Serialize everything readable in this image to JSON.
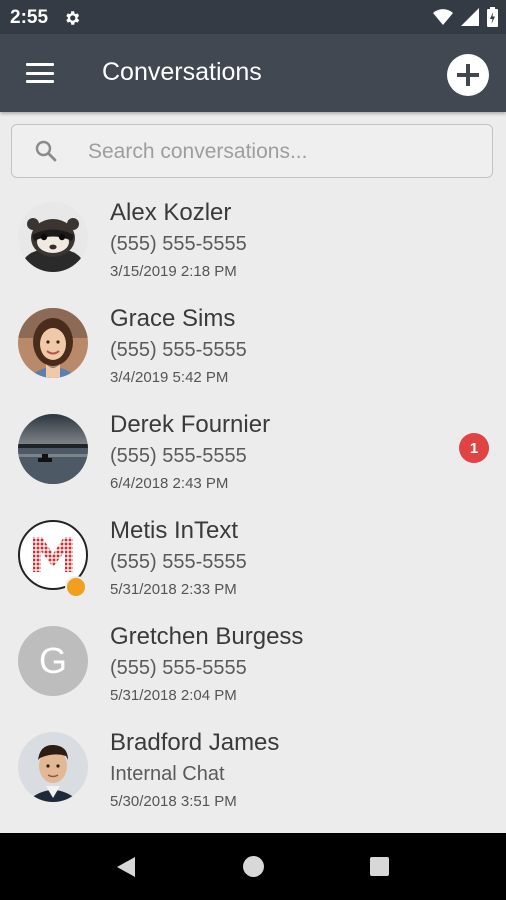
{
  "status_bar": {
    "time": "2:55",
    "icons": [
      "gear-icon",
      "wifi-icon",
      "signal-icon",
      "battery-icon"
    ]
  },
  "app_bar": {
    "title": "Conversations",
    "menu_icon": "menu-icon",
    "add_icon": "plus-icon"
  },
  "search": {
    "placeholder": "Search conversations...",
    "value": ""
  },
  "conversations": [
    {
      "name": "Alex Kozler",
      "subtitle": "(555) 555-5555",
      "timestamp": "3/15/2019 2:18 PM",
      "avatar": "ferret-photo"
    },
    {
      "name": "Grace Sims",
      "subtitle": "(555) 555-5555",
      "timestamp": "3/4/2019 5:42 PM",
      "avatar": "woman-photo"
    },
    {
      "name": "Derek Fournier",
      "subtitle": "(555) 555-5555",
      "timestamp": "6/4/2018 2:43 PM",
      "avatar": "lake-photo",
      "unread": "1"
    },
    {
      "name": "Metis InText",
      "subtitle": "(555) 555-5555",
      "timestamp": "5/31/2018 2:33 PM",
      "avatar": "metis-logo",
      "online": true
    },
    {
      "name": "Gretchen Burgess",
      "subtitle": "(555) 555-5555",
      "timestamp": "5/31/2018 2:04 PM",
      "avatar_letter": "G"
    },
    {
      "name": "Bradford James",
      "subtitle": "Internal Chat",
      "timestamp": "5/30/2018 3:51 PM",
      "avatar": "man-photo"
    }
  ],
  "colors": {
    "status_bar": "#353b45",
    "app_bar": "#414852",
    "background": "#ececec",
    "badge": "#e04343",
    "online_dot": "#f0a01e"
  }
}
